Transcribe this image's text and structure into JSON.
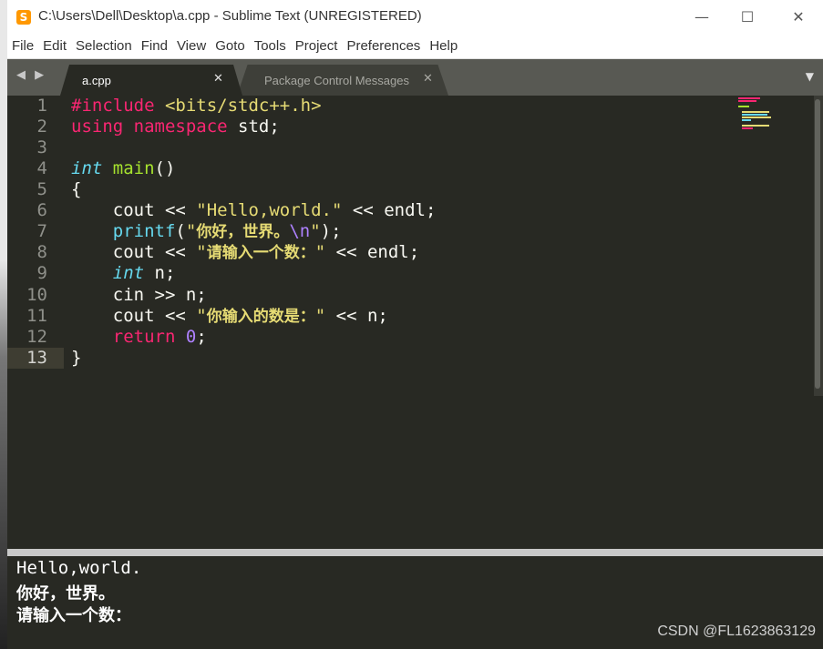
{
  "window": {
    "title": "C:\\Users\\Dell\\Desktop\\a.cpp - Sublime Text (UNREGISTERED)",
    "app_icon": "S",
    "controls": {
      "minimize": "—",
      "maximize": "☐",
      "close": "✕"
    }
  },
  "menu": [
    "File",
    "Edit",
    "Selection",
    "Find",
    "View",
    "Goto",
    "Tools",
    "Project",
    "Preferences",
    "Help"
  ],
  "tabs": {
    "nav": "◀ ▶",
    "active": {
      "label": "a.cpp",
      "close": "✕"
    },
    "inactive": {
      "label": "Package Control Messages",
      "close": "✕"
    },
    "menu": "▼"
  },
  "line_numbers": [
    "1",
    "2",
    "3",
    "4",
    "5",
    "6",
    "7",
    "8",
    "9",
    "10",
    "11",
    "12",
    "13"
  ],
  "active_line": "13",
  "code": {
    "l1": {
      "a": "#include",
      "b": " ",
      "c": "<bits/stdc++.h>"
    },
    "l2": {
      "a": "using",
      "b": " ",
      "c": "namespace",
      "d": " std;"
    },
    "l4": {
      "a": "int",
      "b": " ",
      "c": "main",
      "d": "()"
    },
    "l5": {
      "a": "{"
    },
    "l6": {
      "a": "    cout << ",
      "b": "\"Hello,world.\"",
      "c": " << endl;"
    },
    "l7": {
      "a": "    ",
      "b": "printf",
      "c": "(",
      "d": "\"",
      "e": "你好，世界。",
      "f": "\\n",
      "g": "\"",
      "h": ");"
    },
    "l8": {
      "a": "    cout << ",
      "b": "\"",
      "c": "请输入一个数：",
      "d": "\"",
      "e": " << endl;"
    },
    "l9": {
      "a": "    ",
      "b": "int",
      "c": " n;"
    },
    "l10": {
      "a": "    cin >> n;"
    },
    "l11": {
      "a": "    cout << ",
      "b": "\"",
      "c": "你输入的数是：",
      "d": "\"",
      "e": " << n;"
    },
    "l12": {
      "a": "    ",
      "b": "return",
      "c": " ",
      "d": "0",
      "e": ";"
    },
    "l13": {
      "a": "}"
    }
  },
  "output": [
    "Hello,world.",
    "你好，世界。",
    "请输入一个数："
  ],
  "watermark": "CSDN @FL1623863129",
  "colors": {
    "background": "#282923",
    "keyword": "#f92672",
    "string": "#e6db74",
    "type": "#66d9ef",
    "function": "#a6e22e",
    "number": "#ae81ff",
    "text": "#f8f8f2"
  }
}
